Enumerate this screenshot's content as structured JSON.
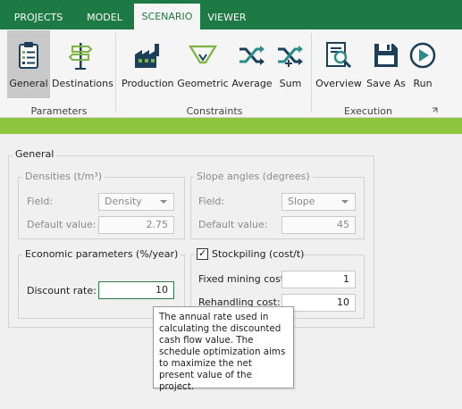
{
  "tabs": [
    {
      "label": "PROJECTS",
      "active": false
    },
    {
      "label": "MODEL",
      "active": false
    },
    {
      "label": "SCENARIO",
      "active": true
    },
    {
      "label": "VIEWER",
      "active": false
    }
  ],
  "ribbon": {
    "buttons": {
      "general": "General",
      "destinations": "Destinations",
      "production": "Production",
      "geometric": "Geometric",
      "average": "Average",
      "sum": "Sum",
      "overview": "Overview",
      "save_as": "Save As",
      "run": "Run"
    },
    "groups": {
      "parameters": "Parameters",
      "constraints": "Constraints",
      "execution": "Execution"
    }
  },
  "colors": {
    "tab_bar": "#1e7a45",
    "accent_band": "#8cc63e",
    "icon_dark": "#1c3f5c",
    "icon_green": "#7cb342",
    "icon_teal": "#2b8a8a"
  },
  "general": {
    "title": "General",
    "densities": {
      "title": "Densities (t/m³)",
      "field_label": "Field:",
      "field_value": "Density",
      "default_label": "Default value:",
      "default_value": "2.75"
    },
    "slope": {
      "title": "Slope angles (degrees)",
      "field_label": "Field:",
      "field_value": "Slope",
      "default_label": "Default value:",
      "default_value": "45"
    },
    "economic": {
      "title": "Economic parameters (%/year)",
      "discount_label": "Discount rate:",
      "discount_value": "10"
    },
    "stockpiling": {
      "title": "Stockpiling (cost/t)",
      "checked": true,
      "check_mark": "✓",
      "fixed_label": "Fixed mining cost:",
      "fixed_value": "1",
      "rehandling_label": "Rehandling cost:",
      "rehandling_value": "10"
    }
  },
  "tooltip": {
    "text": "The annual rate used in calculating the discounted cash flow value. The schedule optimization aims to maximize the net present value of the project."
  }
}
